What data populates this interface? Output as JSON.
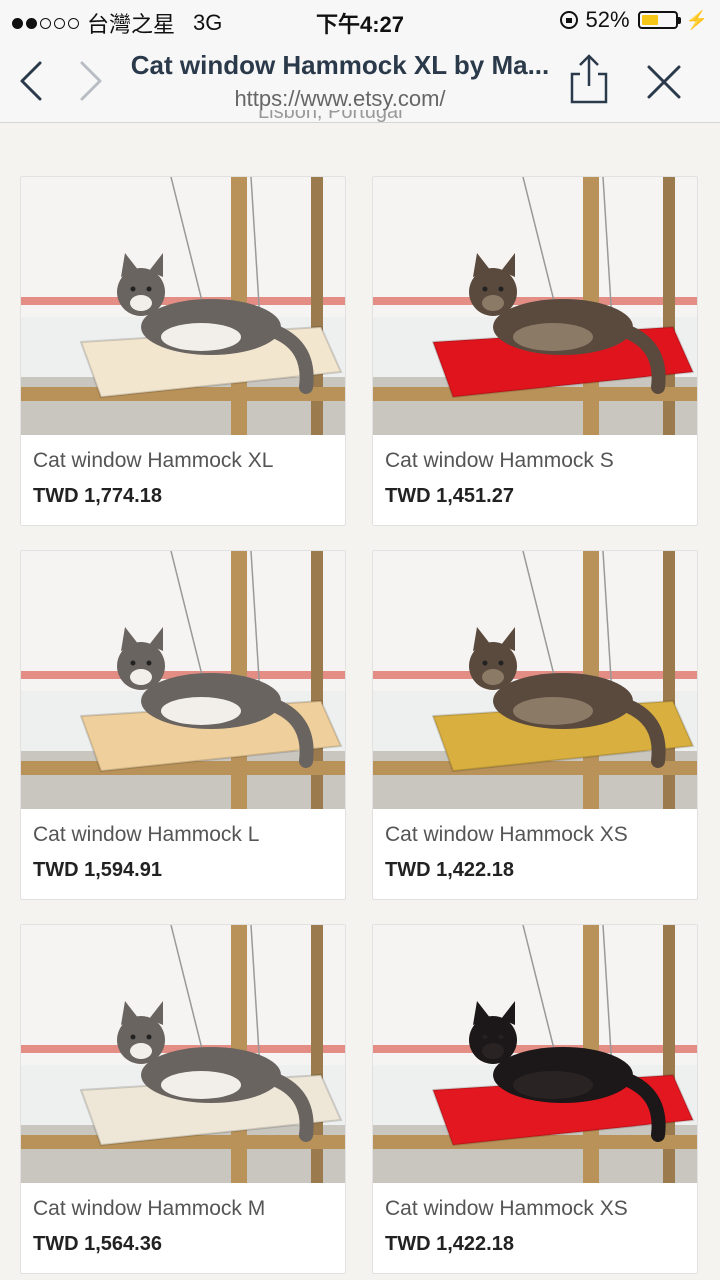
{
  "status_bar": {
    "carrier": "台灣之星",
    "network": "3G",
    "time": "下午4:27",
    "battery_percent": "52%",
    "battery_level": 0.52,
    "battery_color": "#f5c518"
  },
  "browser": {
    "title": "Cat window Hammock XL by Ma...",
    "url": "https://www.etsy.com/",
    "icons": [
      "back-arrow-icon",
      "forward-arrow-icon",
      "share-icon",
      "close-icon"
    ]
  },
  "location_text": "Lisbon, Portugal",
  "listings": [
    {
      "title": "Cat window Hammock XL",
      "price": "TWD 1,774.18",
      "pad_color": "#f3e6cf",
      "cat": "tabby-white"
    },
    {
      "title": "Cat window Hammock S",
      "price": "TWD 1,451.27",
      "pad_color": "#e0141d",
      "cat": "brown-longhair"
    },
    {
      "title": "Cat window Hammock L",
      "price": "TWD 1,594.91",
      "pad_color": "#efcf9c",
      "cat": "tabby-white"
    },
    {
      "title": "Cat window Hammock XS",
      "price": "TWD 1,422.18",
      "pad_color": "#d9b040",
      "cat": "brown-longhair"
    },
    {
      "title": "Cat window Hammock M",
      "price": "TWD 1,564.36",
      "pad_color": "#eee7d8",
      "cat": "tabby-white"
    },
    {
      "title": "Cat window Hammock XS",
      "price": "TWD 1,422.18",
      "pad_color": "#e3171f",
      "cat": "black"
    }
  ]
}
